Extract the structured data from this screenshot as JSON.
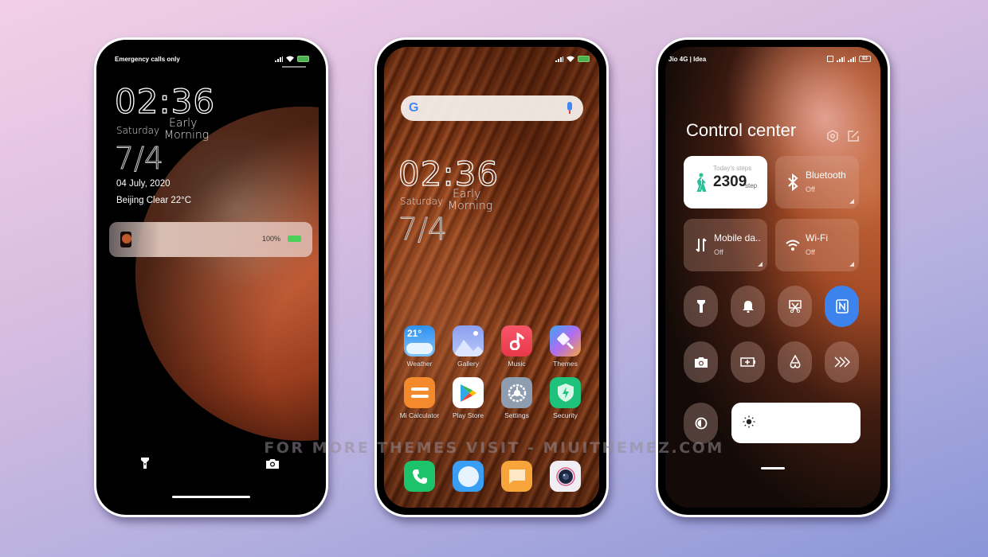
{
  "watermark": "FOR MORE THEMES VISIT - MIUITHEMEZ.COM",
  "lock_screen": {
    "status": {
      "carrier": "Emergency calls only",
      "icons": [
        "signal-icon",
        "wifi-icon",
        "battery-charging-icon"
      ]
    },
    "clock": {
      "time": "02:36",
      "day": "Saturday",
      "period_line1": "Early",
      "period_line2": "Morning",
      "date_short": "7/4"
    },
    "date_full": "04 July, 2020",
    "weather": "Beijing Clear 22°C",
    "notification": {
      "battery_percent": "100%"
    },
    "shortcuts": [
      "flashlight-icon",
      "camera-icon"
    ]
  },
  "home_screen": {
    "status": {
      "icons": [
        "signal-icon",
        "wifi-icon",
        "battery-charging-icon"
      ]
    },
    "search": {
      "logo": "G"
    },
    "clock": {
      "time": "02:36",
      "day": "Saturday",
      "period_line1": "Early",
      "period_line2": "Morning",
      "date_short": "7/4"
    },
    "apps": [
      {
        "label": "Weather",
        "badge": "21°",
        "icon": "weather-icon",
        "color": "#3d9cf0"
      },
      {
        "label": "Gallery",
        "icon": "gallery-icon",
        "color": "#8fa8f2"
      },
      {
        "label": "Music",
        "icon": "music-icon",
        "color": "#f0445a"
      },
      {
        "label": "Themes",
        "icon": "themes-icon",
        "color": "#b86cf0"
      },
      {
        "label": "Mi Calculator",
        "icon": "calculator-icon",
        "color": "#f58a2c"
      },
      {
        "label": "Play Store",
        "icon": "play-store-icon",
        "color": "#ffffff"
      },
      {
        "label": "Settings",
        "icon": "settings-icon",
        "color": "#8f9db0"
      },
      {
        "label": "Security",
        "icon": "security-icon",
        "color": "#1fc27a"
      }
    ],
    "dock": [
      {
        "icon": "phone-icon",
        "color": "#1dc36b"
      },
      {
        "icon": "browser-icon",
        "color": "#3a9ef5"
      },
      {
        "icon": "messages-icon",
        "color": "#f7a43b"
      },
      {
        "icon": "camera-icon",
        "color": "#f1eef3"
      }
    ]
  },
  "control_center": {
    "status": {
      "carrier": "Jio 4G | Idea",
      "icons": [
        "nfc-icon",
        "signal-icon",
        "signal-icon",
        "battery-icon"
      ],
      "battery": "83"
    },
    "title": "Control center",
    "header_icons": [
      "settings-icon",
      "edit-icon"
    ],
    "tiles": [
      {
        "title": "Today's steps",
        "value": "2309",
        "unit": "step",
        "icon": "walking-icon",
        "accent": "#27c29a"
      },
      {
        "title": "Bluetooth",
        "state": "Off",
        "icon": "bluetooth-icon"
      },
      {
        "title": "Mobile da..",
        "state": "Off",
        "icon": "mobile-data-icon"
      },
      {
        "title": "Wi-Fi",
        "state": "Off",
        "icon": "wifi-icon"
      }
    ],
    "toggles": [
      {
        "icon": "flashlight-icon",
        "on": false
      },
      {
        "icon": "bell-icon",
        "on": false
      },
      {
        "icon": "screenshot-icon",
        "on": false
      },
      {
        "icon": "nfc-icon",
        "on": true
      },
      {
        "icon": "camera-icon",
        "on": false
      },
      {
        "icon": "battery-saver-icon",
        "on": false
      },
      {
        "icon": "airplane-icon",
        "on": false
      },
      {
        "icon": "fast-forward-icon",
        "on": false
      },
      {
        "icon": "contrast-icon",
        "on": false
      }
    ],
    "accent": "#3d83ee",
    "brightness_icon": "sun-icon"
  }
}
